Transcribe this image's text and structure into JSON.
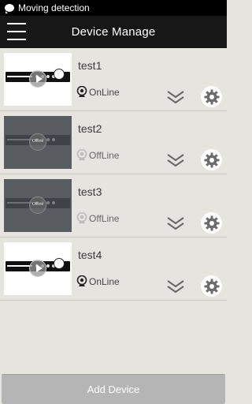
{
  "statusbar": {
    "notification": "Moving detection"
  },
  "appbar": {
    "title": "Device Manage"
  },
  "devices": [
    {
      "name": "test1",
      "status": "OnLine"
    },
    {
      "name": "test2",
      "status": "OffLine",
      "thumb_label": "Offline"
    },
    {
      "name": "test3",
      "status": "OffLine",
      "thumb_label": "Offline"
    },
    {
      "name": "test4",
      "status": "OnLine"
    }
  ],
  "footer": {
    "add_label": "Add Device"
  },
  "colors": {
    "appbar": "#171717",
    "background": "#e6e4df",
    "button": "#b5b5b5",
    "offline_thumb": "#595c61"
  },
  "icons": {
    "menu": "hamburger-icon",
    "status": "webcam-icon",
    "expand": "double-chevron-down-icon",
    "settings": "gear-icon"
  }
}
